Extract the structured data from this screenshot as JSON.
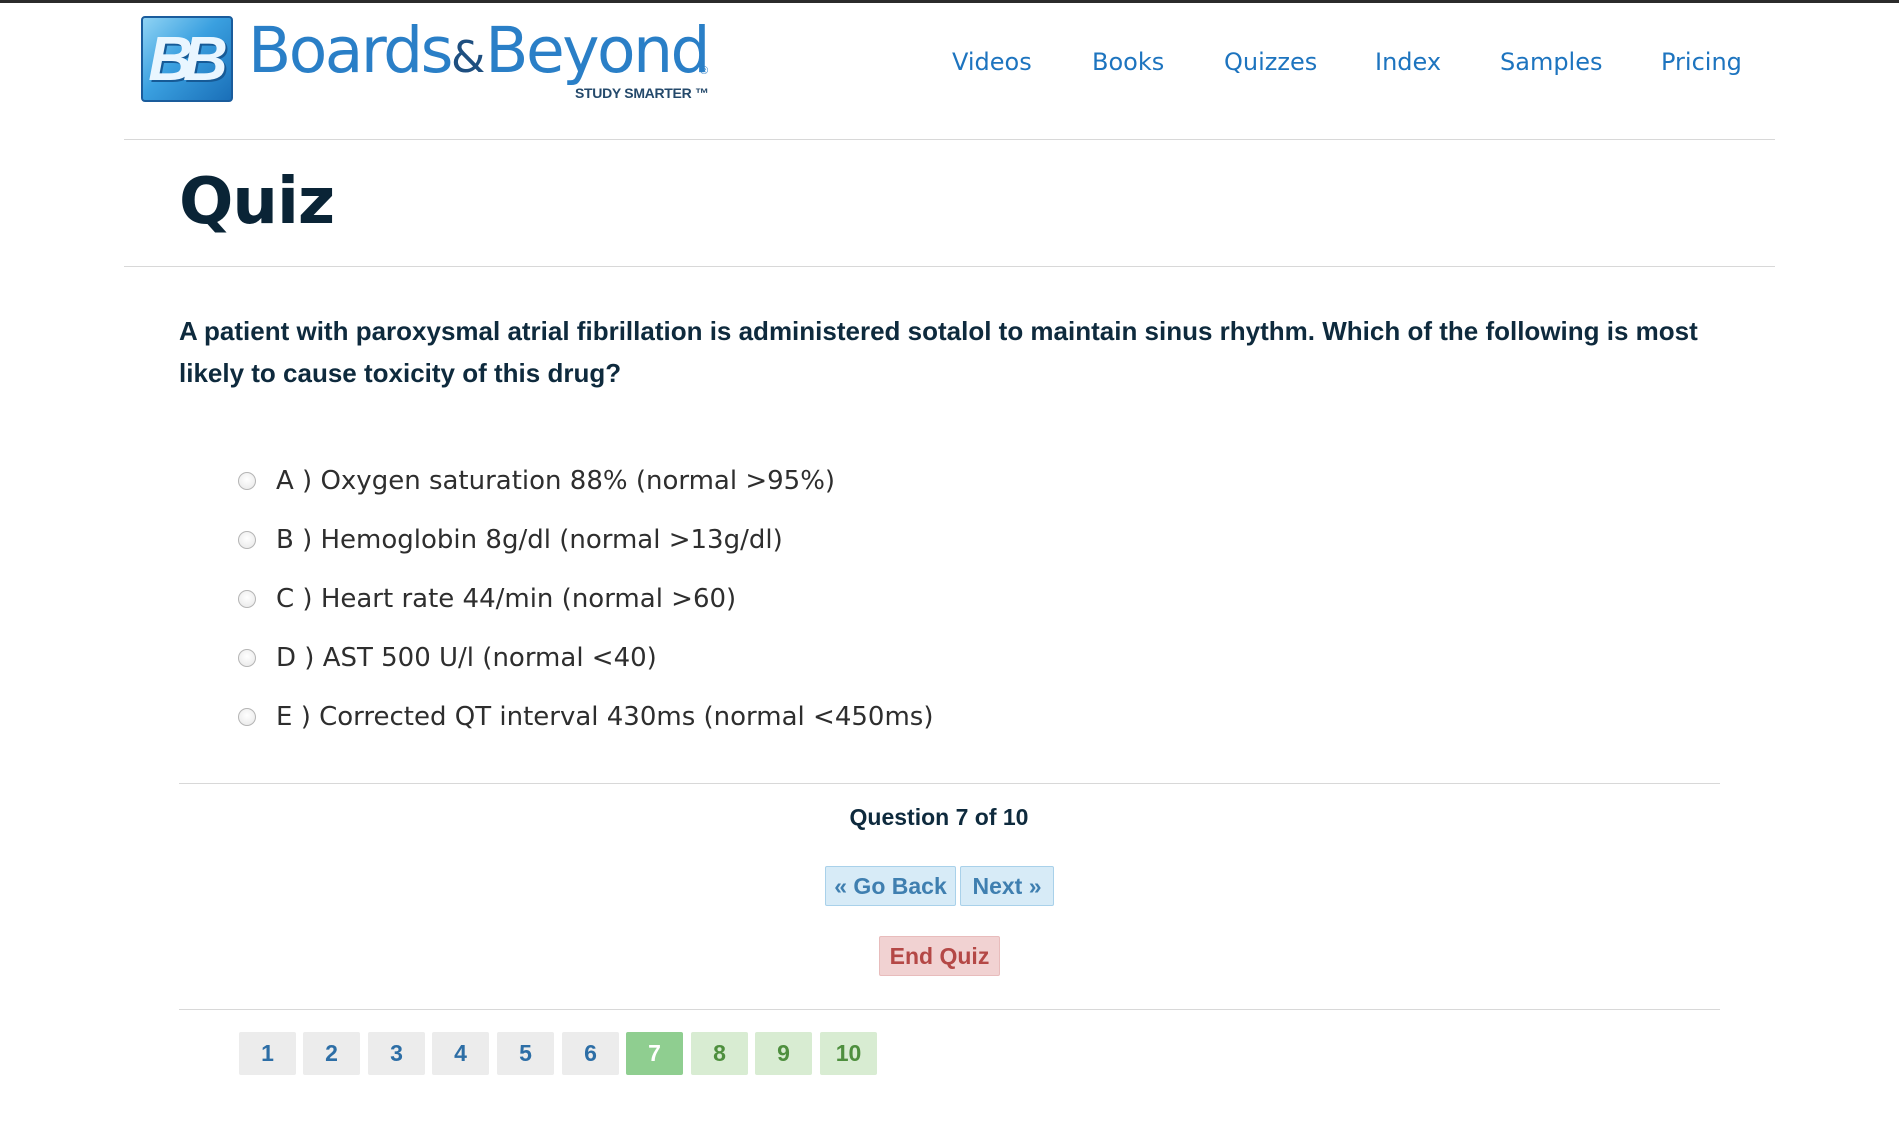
{
  "brand": {
    "mark": "BB",
    "name_part1": "Boards",
    "name_amp": "&",
    "name_part2": "Beyond",
    "registered": "®",
    "tagline": "STUDY SMARTER ™"
  },
  "nav": {
    "items": [
      "Videos",
      "Books",
      "Quizzes",
      "Index",
      "Samples",
      "Pricing"
    ]
  },
  "page": {
    "title": "Quiz"
  },
  "quiz": {
    "question": "A patient with paroxysmal atrial fibrillation is administered sotalol to maintain sinus rhythm. Which of the following is most likely to cause toxicity of this drug?",
    "options": [
      "A ) Oxygen saturation 88% (normal >95%)",
      "B ) Hemoglobin 8g/dl (normal >13g/dl)",
      "C ) Heart rate 44/min (normal >60)",
      "D ) AST 500 U/l (normal <40)",
      "E ) Corrected QT interval 430ms (normal <450ms)"
    ],
    "progress": "Question 7 of 10",
    "current_question": 7,
    "total_questions": 10,
    "go_back_label": "« Go Back",
    "next_label": "Next »",
    "end_label": "End Quiz",
    "pages": [
      "1",
      "2",
      "3",
      "4",
      "5",
      "6",
      "7",
      "8",
      "9",
      "10"
    ]
  },
  "colors": {
    "accent": "#1d74bf",
    "title": "#0a2436",
    "current_page": "#8fce90",
    "upcoming_page": "#d8ecd2",
    "end_button": "#f1d2d2"
  }
}
